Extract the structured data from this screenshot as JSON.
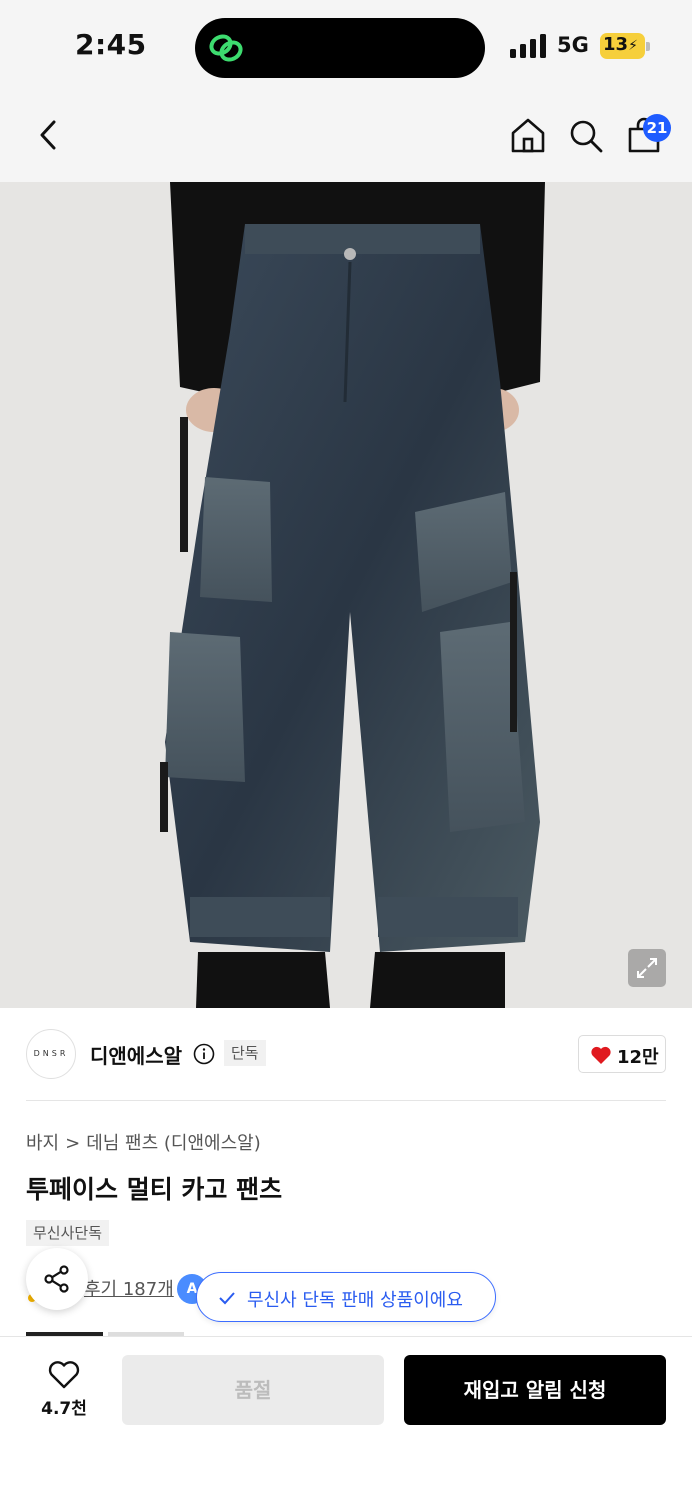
{
  "status_bar": {
    "time": "2:45",
    "network": "5G",
    "battery": "13"
  },
  "nav": {
    "cart_badge": "21"
  },
  "brand": {
    "logo_text": "DNSR",
    "name": "디앤에스알",
    "exclusive_badge": "단독",
    "like_count": "12만"
  },
  "product": {
    "breadcrumb": [
      "바지",
      ">",
      "데님 팬츠 (디앤에스알)"
    ],
    "title": "투페이스 멀티 카고 팬츠",
    "tag": "무신사단독",
    "review_link": "후기 187개",
    "badge_letter": "A"
  },
  "toast": {
    "text": "무신사 단독 판매 상품이에요"
  },
  "bottom_bar": {
    "wish_count": "4.7천",
    "soldout_label": "품절",
    "restock_label": "재입고 알림 신청"
  },
  "colors": {
    "accent_blue": "#2a5cf0",
    "like_red": "#e0191f",
    "battery_yellow": "#f6cf3b"
  }
}
